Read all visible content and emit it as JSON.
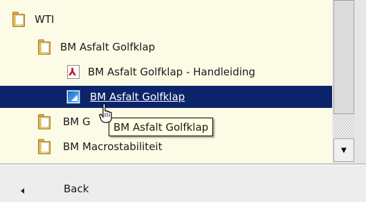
{
  "tree": {
    "items": [
      {
        "label": "WTI",
        "icon": "folder-icon"
      },
      {
        "label": "BM Asfalt Golfklap",
        "icon": "folder-icon"
      },
      {
        "label": "BM Asfalt Golfklap - Handleiding",
        "icon": "pdf-icon"
      },
      {
        "label": "BM Asfalt Golfklap",
        "icon": "application-icon",
        "selected": true
      },
      {
        "label": "BM G",
        "icon": "folder-icon"
      },
      {
        "label": "BM Macrostabiliteit",
        "icon": "folder-icon"
      }
    ]
  },
  "tooltip": {
    "text": "BM Asfalt Golfklap"
  },
  "footer": {
    "back_label": "Back"
  },
  "colors": {
    "selection": "#0c246a",
    "background": "#fbfbe6",
    "tooltip_bg": "#ffffe1"
  }
}
